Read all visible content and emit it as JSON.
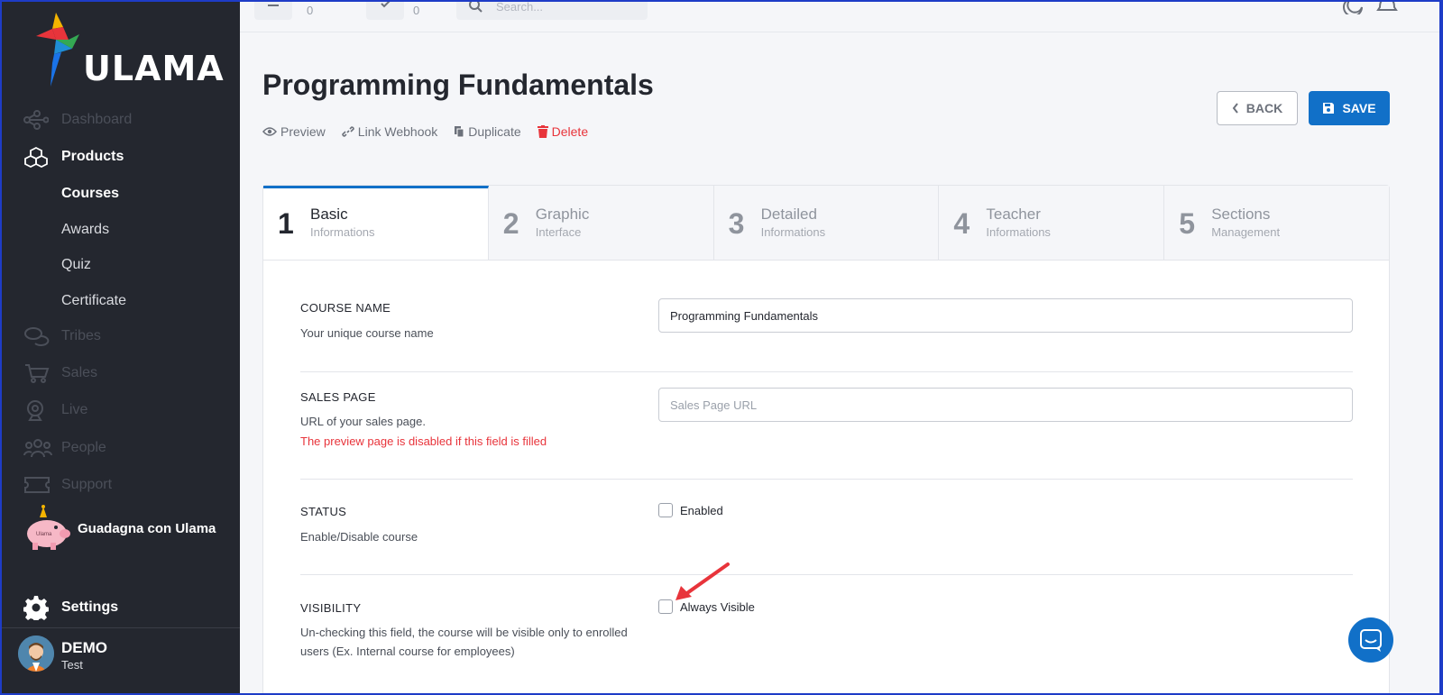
{
  "brand": {
    "name": "ULAMA",
    "accent": "#1170c8"
  },
  "sidebar": {
    "items": [
      {
        "label": "Dashboard",
        "icon": "dashboard-icon"
      },
      {
        "label": "Products",
        "icon": "cubes-icon"
      },
      {
        "label": "Tribes",
        "icon": "comments-icon"
      },
      {
        "label": "Sales",
        "icon": "cart-icon"
      },
      {
        "label": "Live",
        "icon": "webcam-icon"
      },
      {
        "label": "People",
        "icon": "people-icon"
      },
      {
        "label": "Support",
        "icon": "ticket-icon"
      },
      {
        "label": "Settings",
        "icon": "gear-icon"
      }
    ],
    "subitems": [
      "Courses",
      "Awards",
      "Quiz",
      "Certificate"
    ],
    "promo_label": "Guadagna con Ulama",
    "user": {
      "name": "DEMO",
      "role": "Test"
    }
  },
  "topbar": {
    "counts": [
      "0",
      "0"
    ],
    "search_placeholder": "Search..."
  },
  "header": {
    "title": "Programming Fundamentals",
    "actions": {
      "preview": "Preview",
      "webhook": "Link Webhook",
      "duplicate": "Duplicate",
      "delete": "Delete"
    },
    "back_label": "BACK",
    "save_label": "SAVE"
  },
  "steps": [
    {
      "num": "1",
      "title": "Basic",
      "sub": "Informations"
    },
    {
      "num": "2",
      "title": "Graphic",
      "sub": "Interface"
    },
    {
      "num": "3",
      "title": "Detailed",
      "sub": "Informations"
    },
    {
      "num": "4",
      "title": "Teacher",
      "sub": "Informations"
    },
    {
      "num": "5",
      "title": "Sections",
      "sub": "Management"
    }
  ],
  "form": {
    "course_name": {
      "label": "COURSE NAME",
      "desc": "Your unique course name",
      "value": "Programming Fundamentals"
    },
    "sales_page": {
      "label": "SALES PAGE",
      "desc": "URL of your sales page.",
      "warn": "The preview page is disabled if this field is filled",
      "placeholder": "Sales Page URL"
    },
    "status": {
      "label": "STATUS",
      "desc": "Enable/Disable course",
      "check_label": "Enabled"
    },
    "visibility": {
      "label": "VISIBILITY",
      "desc": "Un-checking this field, the course will be visible only to enrolled users (Ex. Internal course for employees)",
      "check_label": "Always Visible"
    }
  }
}
